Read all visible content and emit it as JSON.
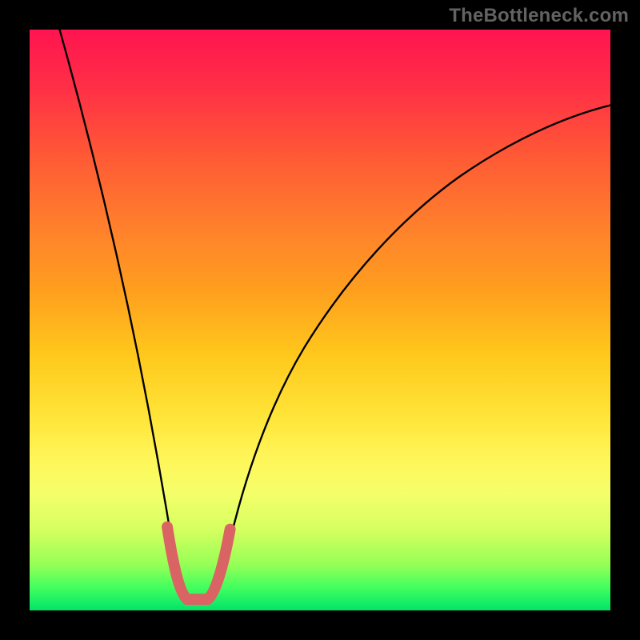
{
  "watermark": "TheBottleneck.com",
  "colors": {
    "page_bg": "#000000",
    "gradient_top": "#ff1450",
    "gradient_mid": "#ffe336",
    "gradient_bottom": "#00e46a",
    "curve_stroke": "#000000",
    "highlight_stroke": "#da6363"
  },
  "chart_data": {
    "type": "line",
    "title": "",
    "xlabel": "",
    "ylabel": "",
    "xlim": [
      0,
      100
    ],
    "ylim": [
      0,
      100
    ],
    "grid": false,
    "legend": false,
    "x": [
      0,
      5,
      10,
      15,
      18,
      20,
      22,
      24,
      25,
      26,
      27,
      28,
      29,
      30,
      31,
      33,
      36,
      40,
      45,
      50,
      55,
      60,
      65,
      70,
      75,
      80,
      85,
      90,
      95,
      100
    ],
    "series": [
      {
        "name": "bottleneck-curve",
        "values": [
          100,
          88,
          72,
          52,
          36,
          24,
          12,
          4,
          1.5,
          1,
          1,
          1,
          1,
          1,
          1.5,
          4,
          12,
          24,
          36,
          46,
          54,
          61,
          66.5,
          71,
          74.5,
          77,
          79,
          80.5,
          81.5,
          82
        ]
      }
    ],
    "minimum": {
      "x_range": [
        25,
        31
      ],
      "y": 1
    },
    "highlighted_segment": {
      "x_start": 22.5,
      "x_end": 33.5
    }
  }
}
